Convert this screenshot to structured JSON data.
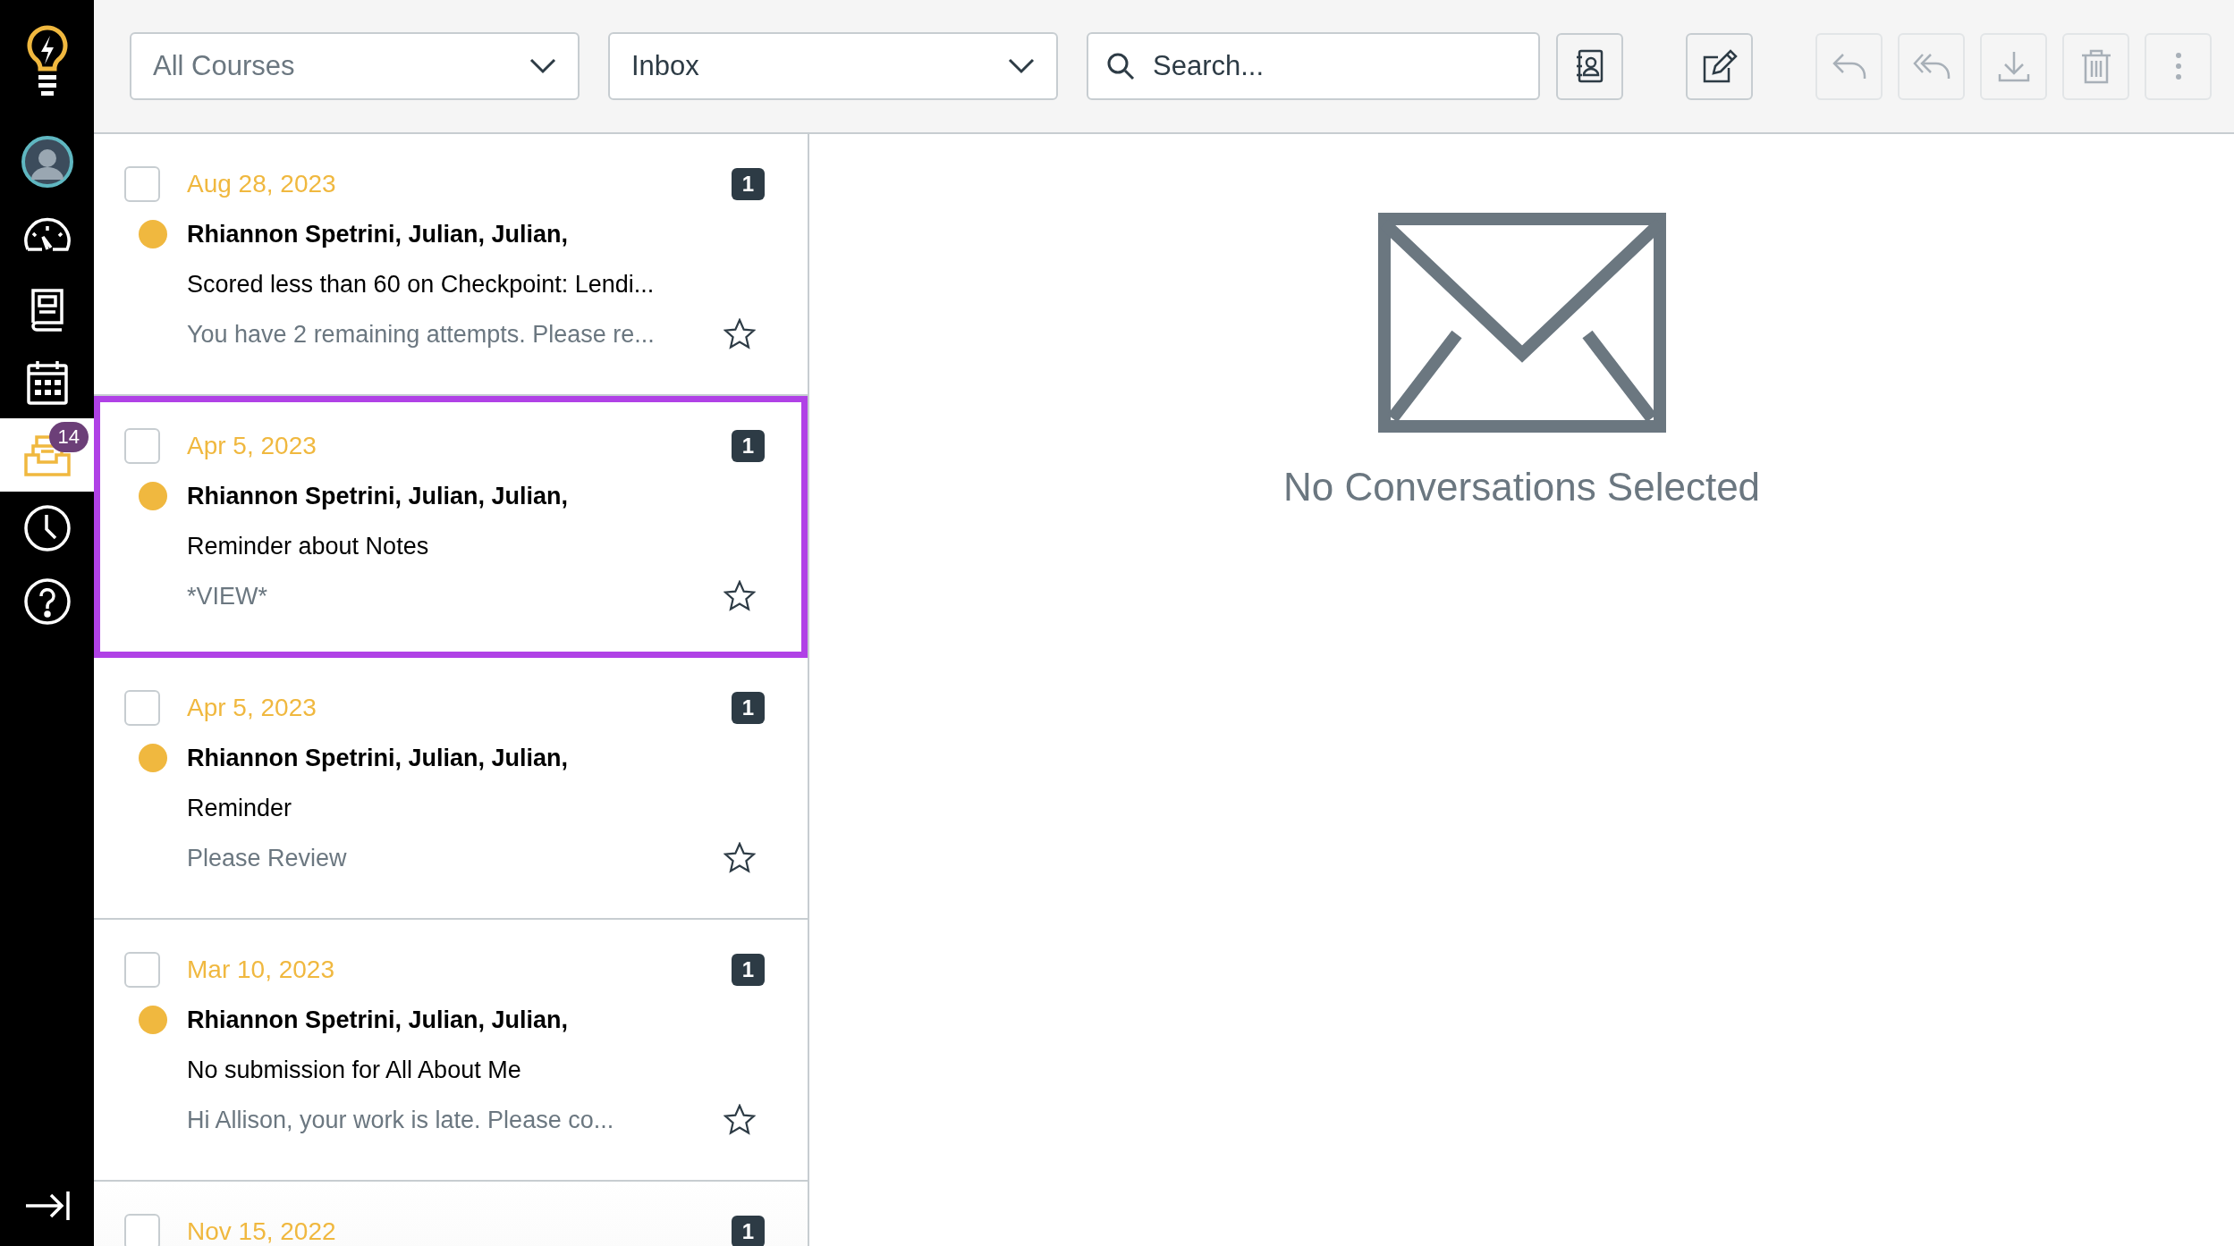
{
  "sidebar": {
    "items": [
      {
        "kind": "logo",
        "selected": false
      },
      {
        "kind": "avatar",
        "selected": false
      },
      {
        "kind": "dashboard",
        "selected": false
      },
      {
        "kind": "courses",
        "selected": false
      },
      {
        "kind": "calendar",
        "selected": false
      },
      {
        "kind": "inbox",
        "selected": true,
        "badge": "14"
      },
      {
        "kind": "history",
        "selected": false
      },
      {
        "kind": "help",
        "selected": false
      }
    ],
    "collapse": {
      "kind": "collapse"
    }
  },
  "toolbar": {
    "course_filter": {
      "value": "All Courses"
    },
    "mailbox_filter": {
      "value": "Inbox"
    },
    "search": {
      "placeholder": "Search..."
    },
    "actions": [
      {
        "kind": "address-book",
        "disabled": false
      },
      {
        "kind": "compose",
        "disabled": false
      },
      {
        "kind": "reply",
        "disabled": true
      },
      {
        "kind": "reply-all",
        "disabled": true
      },
      {
        "kind": "archive",
        "disabled": true
      },
      {
        "kind": "delete",
        "disabled": true
      },
      {
        "kind": "more",
        "disabled": true
      }
    ]
  },
  "conversations": [
    {
      "date": "Aug 28, 2023",
      "count": "1",
      "unread": true,
      "participants": "Rhiannon Spetrini, Julian, Julian,",
      "subject": "Scored less than 60 on Checkpoint: Lendi...",
      "preview": "You have 2 remaining attempts. Please re...",
      "starred": false,
      "highlighted": false
    },
    {
      "date": "Apr 5, 2023",
      "count": "1",
      "unread": true,
      "participants": "Rhiannon Spetrini, Julian, Julian,",
      "subject": "Reminder about Notes",
      "preview": "*VIEW*",
      "starred": false,
      "highlighted": true
    },
    {
      "date": "Apr 5, 2023",
      "count": "1",
      "unread": true,
      "participants": "Rhiannon Spetrini, Julian, Julian,",
      "subject": "Reminder",
      "preview": "Please Review",
      "starred": false,
      "highlighted": false
    },
    {
      "date": "Mar 10, 2023",
      "count": "1",
      "unread": true,
      "participants": "Rhiannon Spetrini, Julian, Julian,",
      "subject": "No submission for All About Me",
      "preview": "Hi Allison, your work is late. Please co...",
      "starred": false,
      "highlighted": false
    },
    {
      "date": "Nov 15, 2022",
      "count": "1",
      "highlighted": false
    }
  ],
  "detail": {
    "empty_message": "No Conversations Selected"
  }
}
